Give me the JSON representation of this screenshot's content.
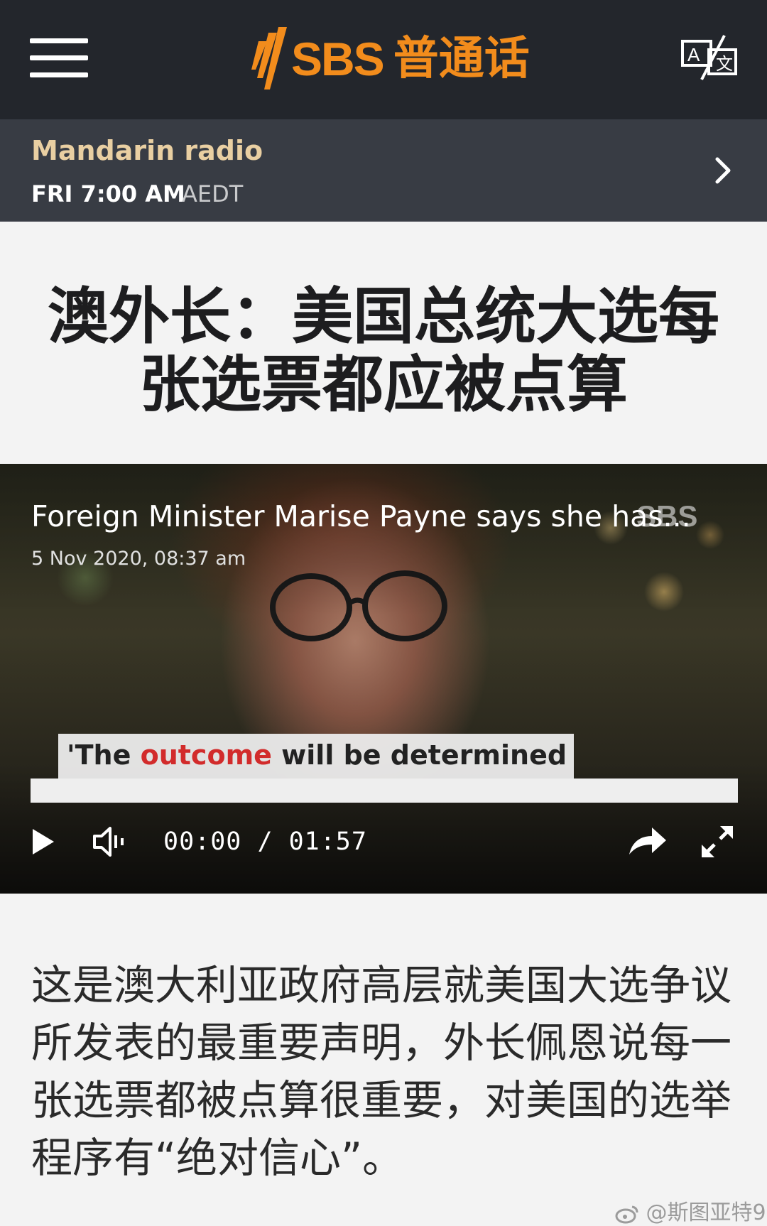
{
  "header": {
    "logo_text": "SBS",
    "logo_cn": "普通话",
    "menu_icon": "hamburger-menu-icon",
    "translate_icon": "translate-icon"
  },
  "radio": {
    "title": "Mandarin radio",
    "time": "FRI 7:00 AM",
    "timezone": "AEDT"
  },
  "article": {
    "headline": "澳外长：美国总统大选每张选票都应被点算",
    "body": "这是澳大利亚政府高层就美国大选争议所发表的最重要声明，外长佩恩说每一张选票都被点算很重要，对美国的选举程序有“绝对信心”。"
  },
  "video": {
    "title": "Foreign Minister Marise Payne says she has...",
    "date": "5 Nov 2020, 08:37 am",
    "watermark": "SBS",
    "caption_prefix": "'The ",
    "caption_highlight": "outcome",
    "caption_suffix": " will be determined",
    "current_time": "00:00",
    "separator": "/",
    "duration": "01:57",
    "progress": 0
  },
  "footer": {
    "credit": "@斯图亚特9"
  },
  "colors": {
    "brand": "#f28c1c",
    "topbar": "#23262c",
    "radio_bar": "#383c44",
    "radio_title": "#e9cfa2"
  }
}
